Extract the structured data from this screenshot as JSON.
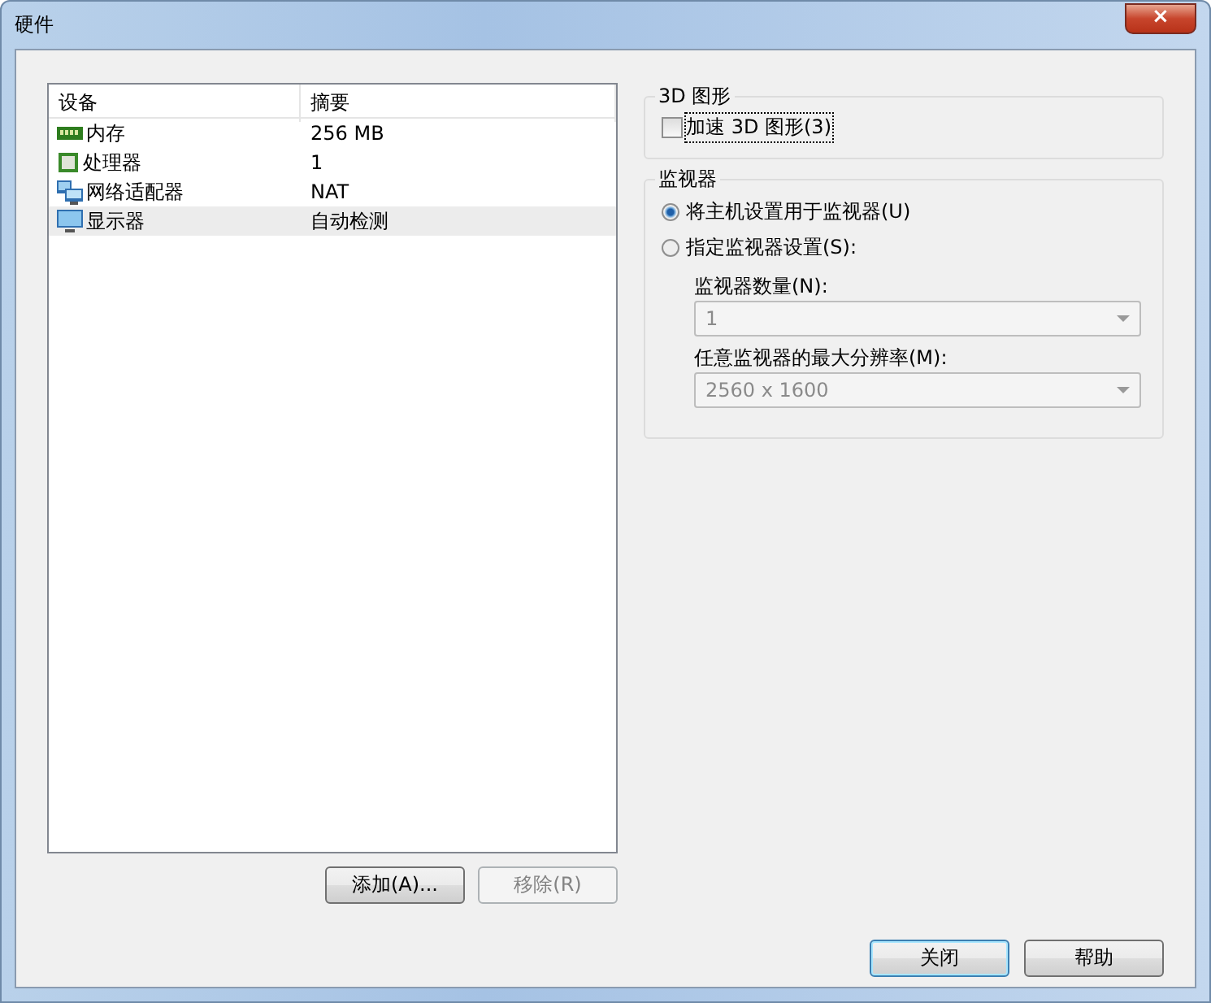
{
  "window": {
    "title": "硬件",
    "close": "×"
  },
  "devices": {
    "columns": [
      "设备",
      "摘要"
    ],
    "rows": [
      {
        "kind": "memory",
        "name": "内存",
        "summary": "256 MB",
        "selected": false
      },
      {
        "kind": "cpu",
        "name": "处理器",
        "summary": "1",
        "selected": false
      },
      {
        "kind": "network",
        "name": "网络适配器",
        "summary": "NAT",
        "selected": false
      },
      {
        "kind": "display",
        "name": "显示器",
        "summary": "自动检测",
        "selected": true
      }
    ]
  },
  "device_buttons": [
    {
      "label": "添加(A)...",
      "disabled": false
    },
    {
      "label": "移除(R)",
      "disabled": true
    }
  ],
  "graphics": {
    "title": "3D 图形",
    "accelerate": {
      "label": "加速 3D 图形(3)",
      "checked": false
    }
  },
  "monitors": {
    "title": "监视器",
    "options": [
      {
        "label": "将主机设置用于监视器(U)",
        "selected": true
      },
      {
        "label": "指定监视器设置(S):",
        "selected": false
      }
    ],
    "fields": [
      {
        "label": "监视器数量(N):",
        "value": "1",
        "disabled": true
      },
      {
        "label": "任意监视器的最大分辨率(M):",
        "value": "2560 x 1600",
        "disabled": true
      }
    ]
  },
  "buttons": [
    {
      "label": "关闭",
      "default": true
    },
    {
      "label": "帮助",
      "default": false
    }
  ]
}
